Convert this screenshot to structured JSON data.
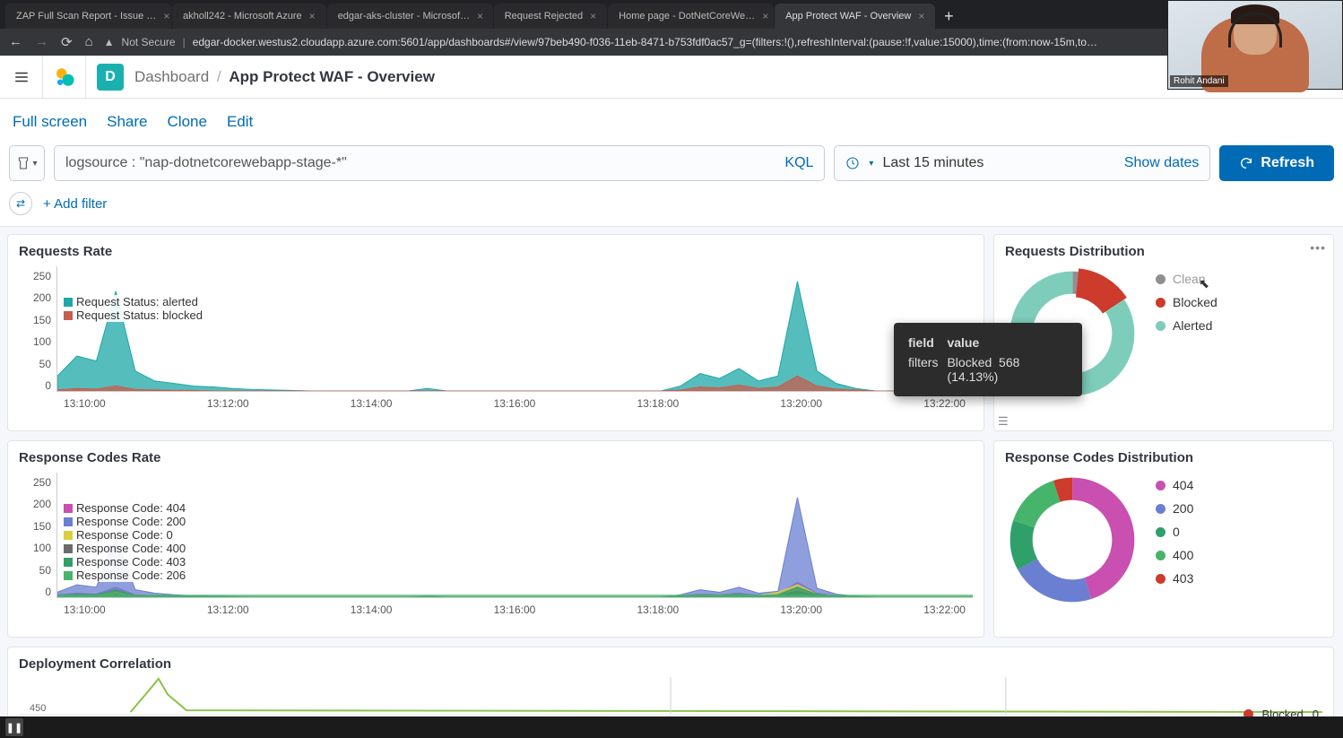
{
  "browser": {
    "tabs": [
      {
        "label": "ZAP Full Scan Report - Issue …"
      },
      {
        "label": "akholl242 - Microsoft Azure"
      },
      {
        "label": "edgar-aks-cluster - Microsof…"
      },
      {
        "label": "Request Rejected"
      },
      {
        "label": "Home page - DotNetCoreWe…"
      },
      {
        "label": "App Protect WAF - Overview",
        "active": true
      }
    ],
    "security": "Not Secure",
    "url": "edgar-docker.westus2.cloudapp.azure.com:5601/app/dashboards#/view/97beb490-f036-11eb-8471-b753fdf0ac57_g=(filters:!(),refreshInterval:(pause:!f,value:15000),time:(from:now-15m,to…"
  },
  "header": {
    "d_badge": "D",
    "crumb_root": "Dashboard",
    "crumb_page": "App Protect WAF - Overview"
  },
  "actions": {
    "fullscreen": "Full screen",
    "share": "Share",
    "clone": "Clone",
    "edit": "Edit"
  },
  "query": {
    "text": "logsource : \"nap-dotnetcorewebapp-stage-*\"",
    "lang": "KQL",
    "timerange": "Last 15 minutes",
    "showdates": "Show dates",
    "refresh": "Refresh",
    "addfilter": "+ Add filter"
  },
  "panels": {
    "requests_rate": {
      "title": "Requests Rate",
      "legend": [
        {
          "label": "Request Status: alerted",
          "color": "#1ea7a7"
        },
        {
          "label": "Request Status: blocked",
          "color": "#c75d4d"
        }
      ]
    },
    "requests_dist": {
      "title": "Requests Distribution",
      "tooltip": {
        "h_field": "field",
        "h_value": "value",
        "r_field": "filters",
        "r_cat": "Blocked",
        "r_val": "568 (14.13%)"
      },
      "legend": [
        {
          "label": "Clean",
          "color": "#8f8f8f"
        },
        {
          "label": "Blocked",
          "color": "#cc3b2b"
        },
        {
          "label": "Alerted",
          "color": "#7ecdbb"
        }
      ]
    },
    "response_rate": {
      "title": "Response Codes Rate",
      "legend": [
        {
          "label": "Response Code: 404",
          "color": "#c94fb1"
        },
        {
          "label": "Response Code: 200",
          "color": "#6a7fd1"
        },
        {
          "label": "Response Code: 0",
          "color": "#d9cf3e"
        },
        {
          "label": "Response Code: 400",
          "color": "#6b6b6b"
        },
        {
          "label": "Response Code: 403",
          "color": "#2fa06a"
        },
        {
          "label": "Response Code: 206",
          "color": "#46b56b"
        }
      ]
    },
    "response_dist": {
      "title": "Response Codes Distribution",
      "legend": [
        {
          "label": "404",
          "color": "#c94fb1"
        },
        {
          "label": "200",
          "color": "#6a7fd1"
        },
        {
          "label": "0",
          "color": "#2fa06a"
        },
        {
          "label": "400",
          "color": "#46b56b"
        },
        {
          "label": "403",
          "color": "#cc3b2b"
        }
      ]
    },
    "deployment": {
      "title": "Deployment Correlation",
      "ytick": "450",
      "legend": [
        {
          "label": "Blocked",
          "value": "0",
          "color": "#cc3b2b"
        }
      ]
    }
  },
  "chart_data": {
    "requests_rate": {
      "type": "line",
      "ylim": [
        0,
        250
      ],
      "yticks": [
        0,
        50,
        100,
        150,
        200,
        250
      ],
      "xticks": [
        "13:10:00",
        "13:12:00",
        "13:14:00",
        "13:16:00",
        "13:18:00",
        "13:20:00",
        "13:22:00"
      ],
      "series": [
        {
          "name": "alerted",
          "color": "#1ea7a7",
          "values": [
            30,
            70,
            60,
            200,
            40,
            20,
            15,
            10,
            8,
            5,
            3,
            2,
            1,
            0,
            0,
            0,
            0,
            0,
            0,
            5,
            0,
            0,
            0,
            0,
            0,
            0,
            0,
            0,
            0,
            0,
            0,
            0,
            10,
            35,
            25,
            45,
            20,
            30,
            220,
            40,
            15,
            5,
            0,
            0,
            0,
            0,
            0,
            0
          ]
        },
        {
          "name": "blocked",
          "color": "#c75d4d",
          "values": [
            2,
            5,
            4,
            10,
            3,
            2,
            1,
            1,
            0,
            0,
            0,
            0,
            0,
            0,
            0,
            0,
            0,
            0,
            0,
            0,
            0,
            0,
            0,
            0,
            0,
            0,
            0,
            0,
            0,
            0,
            0,
            0,
            2,
            8,
            6,
            12,
            5,
            8,
            30,
            10,
            4,
            2,
            0,
            0,
            0,
            0,
            0,
            0
          ]
        }
      ]
    },
    "requests_dist": {
      "type": "pie",
      "slices": [
        {
          "name": "Clean",
          "pct": 1.5,
          "color": "#8f8f8f"
        },
        {
          "name": "Blocked",
          "pct": 14.13,
          "color": "#cc3b2b",
          "value": 568
        },
        {
          "name": "Alerted",
          "pct": 84.37,
          "color": "#7ecdbb"
        }
      ]
    },
    "response_rate": {
      "type": "line",
      "ylim": [
        0,
        250
      ],
      "yticks": [
        0,
        50,
        100,
        150,
        200,
        250
      ],
      "xticks": [
        "13:10:00",
        "13:12:00",
        "13:14:00",
        "13:16:00",
        "13:18:00",
        "13:20:00",
        "13:22:00"
      ],
      "series": [
        {
          "name": "404",
          "color": "#c94fb1",
          "values": [
            5,
            8,
            6,
            20,
            5,
            3,
            2,
            1,
            1,
            0,
            0,
            0,
            0,
            0,
            0,
            0,
            0,
            0,
            0,
            0,
            0,
            0,
            0,
            0,
            0,
            0,
            0,
            0,
            0,
            0,
            0,
            0,
            3,
            6,
            5,
            8,
            4,
            6,
            30,
            8,
            3,
            1,
            0,
            0,
            0,
            0,
            0,
            0
          ]
        },
        {
          "name": "200",
          "color": "#6a7fd1",
          "values": [
            10,
            25,
            20,
            120,
            15,
            8,
            5,
            3,
            2,
            1,
            0,
            0,
            0,
            0,
            0,
            0,
            0,
            0,
            0,
            2,
            0,
            0,
            0,
            0,
            0,
            0,
            0,
            0,
            0,
            0,
            0,
            0,
            5,
            15,
            10,
            20,
            8,
            12,
            200,
            18,
            6,
            2,
            0,
            0,
            0,
            0,
            0,
            0
          ]
        },
        {
          "name": "0",
          "color": "#d9cf3e",
          "values": [
            2,
            4,
            3,
            10,
            2,
            1,
            1,
            0,
            0,
            0,
            0,
            0,
            0,
            0,
            0,
            0,
            0,
            0,
            0,
            0,
            0,
            0,
            0,
            0,
            0,
            0,
            0,
            0,
            0,
            0,
            0,
            0,
            2,
            5,
            4,
            6,
            3,
            10,
            25,
            6,
            2,
            1,
            0,
            0,
            0,
            0,
            0,
            0
          ]
        },
        {
          "name": "400",
          "color": "#6b6b6b",
          "values": [
            1,
            2,
            2,
            5,
            1,
            1,
            0,
            0,
            0,
            0,
            0,
            0,
            0,
            0,
            0,
            0,
            0,
            0,
            0,
            0,
            0,
            0,
            0,
            0,
            0,
            0,
            0,
            0,
            0,
            0,
            0,
            0,
            1,
            3,
            2,
            4,
            2,
            3,
            12,
            4,
            1,
            0,
            0,
            0,
            0,
            0,
            0,
            0
          ]
        },
        {
          "name": "403",
          "color": "#2fa06a",
          "values": [
            3,
            6,
            5,
            15,
            3,
            2,
            1,
            1,
            0,
            0,
            0,
            0,
            0,
            0,
            0,
            0,
            0,
            0,
            0,
            0,
            0,
            0,
            0,
            0,
            0,
            0,
            0,
            0,
            0,
            0,
            0,
            0,
            2,
            5,
            4,
            6,
            3,
            5,
            20,
            6,
            2,
            1,
            0,
            0,
            0,
            0,
            0,
            0
          ]
        },
        {
          "name": "206",
          "color": "#46b56b",
          "values": [
            4,
            4,
            4,
            4,
            4,
            4,
            4,
            4,
            4,
            4,
            4,
            4,
            4,
            4,
            4,
            4,
            4,
            4,
            4,
            4,
            4,
            4,
            4,
            4,
            4,
            4,
            4,
            4,
            4,
            4,
            4,
            4,
            4,
            4,
            4,
            4,
            4,
            4,
            4,
            4,
            4,
            4,
            4,
            4,
            4,
            4,
            4,
            4
          ]
        }
      ]
    },
    "response_dist": {
      "type": "pie",
      "slices": [
        {
          "name": "404",
          "pct": 45,
          "color": "#c94fb1"
        },
        {
          "name": "200",
          "pct": 22,
          "color": "#6a7fd1"
        },
        {
          "name": "0",
          "pct": 13,
          "color": "#2fa06a"
        },
        {
          "name": "400",
          "pct": 15,
          "color": "#46b56b"
        },
        {
          "name": "403",
          "pct": 5,
          "color": "#cc3b2b"
        }
      ]
    }
  },
  "webcam": {
    "name": "Rohit Andani"
  }
}
